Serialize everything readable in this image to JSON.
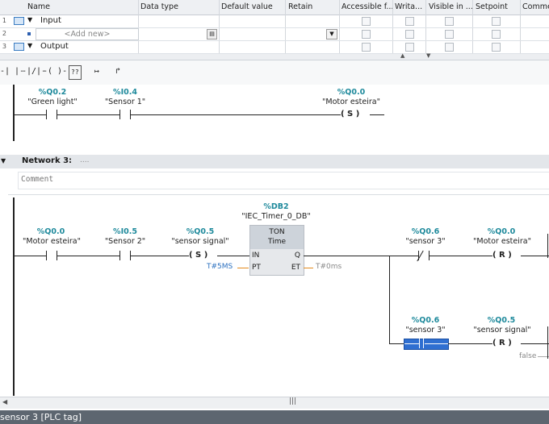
{
  "table": {
    "headers": [
      "Name",
      "Data type",
      "Default value",
      "Retain",
      "Accessible f...",
      "Writa...",
      "Visible in ...",
      "Setpoint",
      "Comme"
    ],
    "rows": [
      {
        "num": "1",
        "name": "Input"
      },
      {
        "num": "2",
        "name": "<Add new>"
      },
      {
        "num": "3",
        "name": "Output"
      }
    ]
  },
  "toolbar": {
    "items": [
      "-| |-",
      "-|/|-",
      "-( )-",
      "??",
      "↦",
      "↱"
    ]
  },
  "network2": {
    "contacts": [
      {
        "addr": "%Q0.2",
        "sym": "\"Green light\""
      },
      {
        "addr": "%I0.4",
        "sym": "\"Sensor 1\""
      }
    ],
    "coil": {
      "addr": "%Q0.0",
      "sym": "\"Motor esteira\"",
      "type": "( S )"
    }
  },
  "network3": {
    "title": "Network 3:",
    "title_extra": "....",
    "comment": "Comment",
    "contacts": [
      {
        "addr": "%Q0.0",
        "sym": "\"Motor esteira\""
      },
      {
        "addr": "%I0.5",
        "sym": "\"Sensor 2\""
      }
    ],
    "set_coil": {
      "addr": "%Q0.5",
      "sym": "\"sensor signal\"",
      "type": "( S )"
    },
    "timer": {
      "db_addr": "%DB2",
      "db_name": "\"IEC_Timer_0_DB\"",
      "type": "TON",
      "subtype": "Time",
      "pin_in": "IN",
      "pin_pt": "PT",
      "pin_q": "Q",
      "pin_et": "ET",
      "pt_value": "T#5MS",
      "et_value": "T#0ms"
    },
    "branch1": {
      "contact": {
        "addr": "%Q0.6",
        "sym": "\"sensor 3\""
      },
      "coil": {
        "addr": "%Q0.0",
        "sym": "\"Motor esteira\"",
        "type": "( R )"
      }
    },
    "branch2": {
      "contact": {
        "addr": "%Q0.6",
        "sym": "\"sensor 3\""
      },
      "coil": {
        "addr": "%Q0.5",
        "sym": "\"sensor signal\"",
        "type": "( R )"
      },
      "false_label": "false"
    }
  },
  "statusbar": {
    "text": "sensor 3 [PLC tag]"
  },
  "colors": {
    "accent": "#1f8a9c",
    "selection": "#2f6fd1",
    "status": "#5d6670"
  }
}
